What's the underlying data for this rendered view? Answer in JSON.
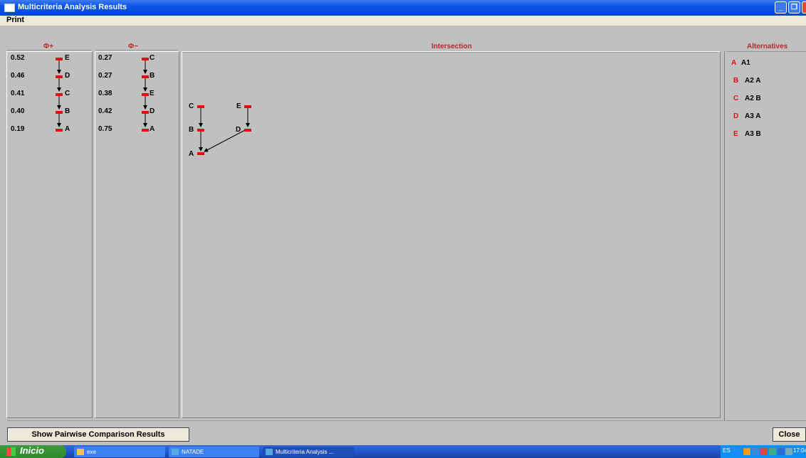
{
  "window": {
    "title": "Multicriteria Analysis Results"
  },
  "menu": {
    "print": "Print"
  },
  "headers": {
    "phi_plus": "Φ+",
    "phi_minus": "Φ−",
    "intersection": "Intersection",
    "alternatives": "Alternatives"
  },
  "phi_plus": [
    {
      "value": "0.52",
      "letter": "E"
    },
    {
      "value": "0.46",
      "letter": "D"
    },
    {
      "value": "0.41",
      "letter": "C"
    },
    {
      "value": "0.40",
      "letter": "B"
    },
    {
      "value": "0.19",
      "letter": "A"
    }
  ],
  "phi_minus": [
    {
      "value": "0.27",
      "letter": "C"
    },
    {
      "value": "0.27",
      "letter": "B"
    },
    {
      "value": "0.38",
      "letter": "E"
    },
    {
      "value": "0.42",
      "letter": "D"
    },
    {
      "value": "0.75",
      "letter": "A"
    }
  ],
  "intersection": {
    "nodes": [
      "C",
      "E",
      "B",
      "D",
      "A"
    ],
    "edges": [
      [
        "C",
        "B"
      ],
      [
        "B",
        "A"
      ],
      [
        "E",
        "D"
      ],
      [
        "D",
        "A"
      ]
    ]
  },
  "alternatives": [
    {
      "letter": "A",
      "name": "A1"
    },
    {
      "letter": "B",
      "name": "A2 A"
    },
    {
      "letter": "C",
      "name": "A2 B"
    },
    {
      "letter": "D",
      "name": "A3 A"
    },
    {
      "letter": "E",
      "name": "A3 B"
    }
  ],
  "buttons": {
    "pairwise": "Show Pairwise Comparison Results",
    "close": "Close"
  },
  "taskbar": {
    "start": "Inicio",
    "items": [
      "exe",
      "NATADE",
      "Multicriteria Analysis ..."
    ],
    "lang": "ES",
    "clock": "17:04"
  },
  "colors": {
    "accent_red": "#e01010",
    "header_red": "#c0262a",
    "titlebar_blue": "#0a55e6"
  }
}
